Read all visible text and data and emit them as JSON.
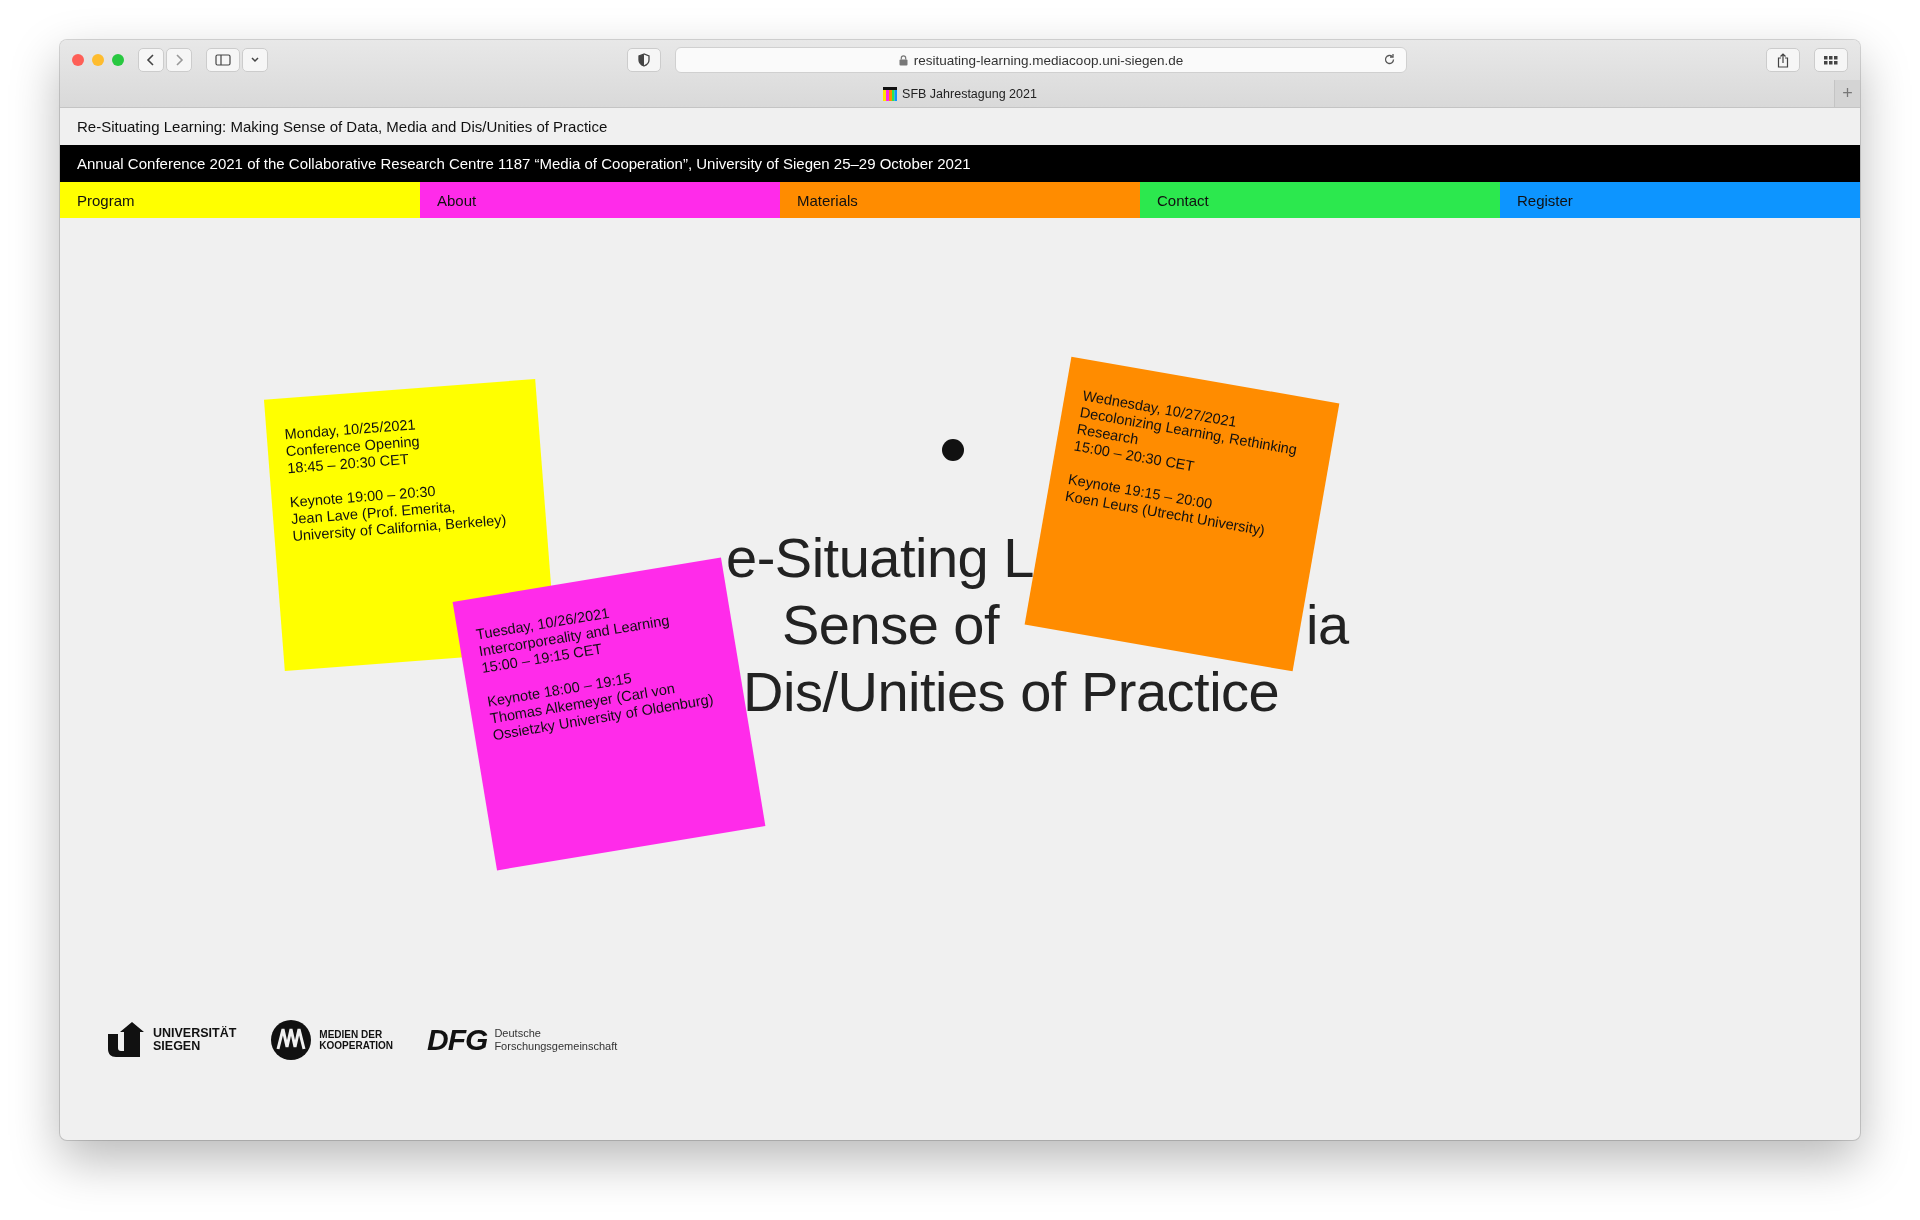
{
  "browser": {
    "url": "resituating-learning.mediacoop.uni-siegen.de",
    "tab_title": "SFB Jahrestagung 2021",
    "new_tab": "+"
  },
  "site_title": "Re-Situating Learning: Making Sense of Data, Media and Dis/Unities of Practice",
  "banner": "Annual Conference 2021 of the Collaborative Research Centre 1187 “Media of Cooperation”, University of Siegen 25–29 October 2021",
  "nav": [
    {
      "label": "Program",
      "color": "#ffff00"
    },
    {
      "label": "About",
      "color": "#ff2bea"
    },
    {
      "label": "Materials",
      "color": "#ff8c00"
    },
    {
      "label": "Contact",
      "color": "#2ce84e"
    },
    {
      "label": "Register",
      "color": "#0d95ff"
    }
  ],
  "hero_title_fragments": [
    "e-Situating L",
    "Sense of",
    "ia",
    "Dis/Unities of Practice"
  ],
  "notes": [
    {
      "color": "#ffff00",
      "session": [
        "Monday, 10/25/2021",
        "Conference Opening",
        "18:45 – 20:30 CET"
      ],
      "keynote": [
        "Keynote 19:00 – 20:30",
        "Jean Lave (Prof. Emerita,",
        "University of California, Berkeley)"
      ]
    },
    {
      "color": "#ff2bea",
      "session": [
        "Tuesday, 10/26/2021",
        "Intercorporeality and Learning",
        "15:00 – 19:15 CET"
      ],
      "keynote": [
        "Keynote 18:00 – 19:15",
        "Thomas Alkemeyer (Carl von",
        "Ossietzky University of Oldenburg)"
      ]
    },
    {
      "color": "#ff8c00",
      "session": [
        "Wednesday, 10/27/2021",
        "Decolonizing Learning, Rethinking",
        "Research",
        "15:00 – 20:30 CET"
      ],
      "keynote": [
        "Keynote 19:15 – 20:00",
        "Koen Leurs (Utrecht University)"
      ]
    }
  ],
  "footer_logos": [
    {
      "kind": "siegen",
      "lines": [
        "UNIVERSITÄT",
        "SIEGEN"
      ]
    },
    {
      "kind": "medien",
      "lines": [
        "MEDIEN DER",
        "KOOPERATION"
      ]
    },
    {
      "kind": "dfg",
      "mark": "DFG",
      "lines": [
        "Deutsche",
        "Forschungsgemeinschaft"
      ]
    }
  ]
}
